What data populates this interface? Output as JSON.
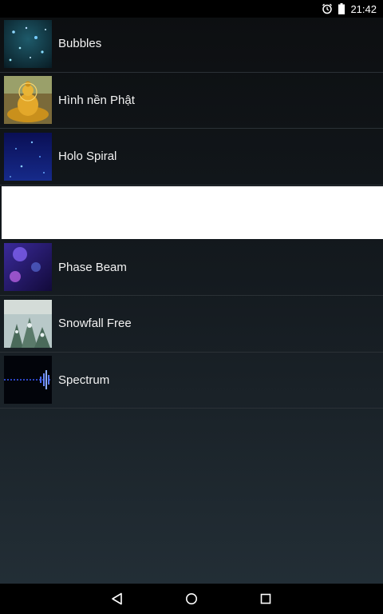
{
  "status_bar": {
    "time": "21:42",
    "icons": [
      "alarm-icon",
      "battery-icon"
    ]
  },
  "wallpapers": [
    {
      "label": "Bubbles",
      "thumb_icon": "bubbles-thumbnail"
    },
    {
      "label": "Hình nền Phật",
      "thumb_icon": "buddha-thumbnail"
    },
    {
      "label": "Holo Spiral",
      "thumb_icon": "holo-spiral-thumbnail"
    },
    {
      "label": "",
      "thumb_icon": ""
    },
    {
      "label": "Phase Beam",
      "thumb_icon": "phase-beam-thumbnail"
    },
    {
      "label": "Snowfall Free",
      "thumb_icon": "snowfall-thumbnail"
    },
    {
      "label": "Spectrum",
      "thumb_icon": "spectrum-thumbnail"
    }
  ],
  "nav_bar": {
    "buttons": [
      "back-icon",
      "home-icon",
      "recents-icon"
    ]
  }
}
